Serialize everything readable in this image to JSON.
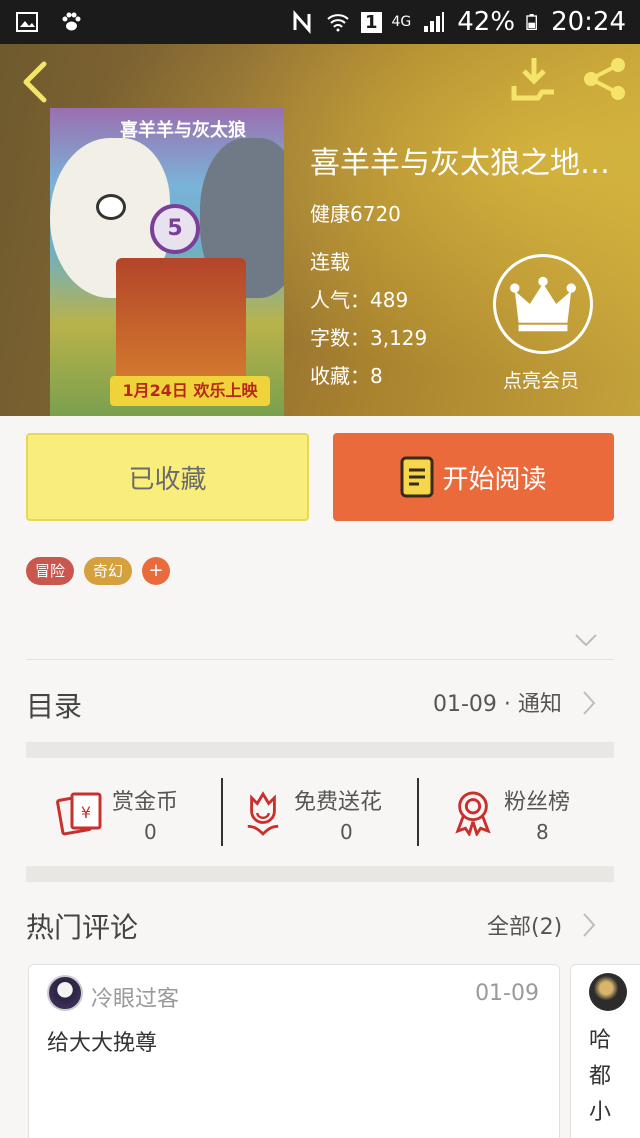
{
  "status_bar": {
    "battery": "42%",
    "time": "20:24",
    "network": "4G",
    "sim": "1",
    "icons": [
      "gallery-icon",
      "paw-icon",
      "nfc-icon",
      "wifi-icon",
      "signal-icon",
      "battery-icon"
    ]
  },
  "header": {
    "back_icon": "chevron-left-icon",
    "download_icon": "download-icon",
    "share_icon": "share-icon"
  },
  "book": {
    "title": "喜羊羊与灰太狼之地底…",
    "author": "健康6720",
    "status": "连载",
    "popularity": "人气：489",
    "word_count": "字数：3,129",
    "favorites": "收藏：8",
    "cover": {
      "number": "5",
      "date_text": "1月24日 欢乐上映",
      "top_text": "喜羊羊与灰太狼"
    }
  },
  "vip": {
    "label": "点亮会员",
    "icon": "crown-icon"
  },
  "actions": {
    "favorited_label": "已收藏",
    "read_label": "开始阅读"
  },
  "tags": {
    "items": [
      "冒险",
      "奇幻"
    ],
    "add": "+"
  },
  "catalog": {
    "label": "目录",
    "update": "01-09 · 通知"
  },
  "stats": {
    "reward": {
      "label": "赏金币",
      "value": "0"
    },
    "flower": {
      "label": "免费送花",
      "value": "0"
    },
    "fans": {
      "label": "粉丝榜",
      "value": "8"
    }
  },
  "hot_comments": {
    "label": "热门评论",
    "all_label": "全部(2)",
    "items": [
      {
        "user": "冷眼过客",
        "date": "01-09",
        "text": "给大大挽尊"
      },
      {
        "user": "",
        "date": "",
        "text": "哈都小"
      }
    ]
  },
  "colors": {
    "favorite_button": "#f9ee7c",
    "read_button": "#ea6a3c",
    "tag_adventure": "#c9574e",
    "tag_fantasy": "#d5a03e",
    "stat_icon": "#c9302c"
  }
}
